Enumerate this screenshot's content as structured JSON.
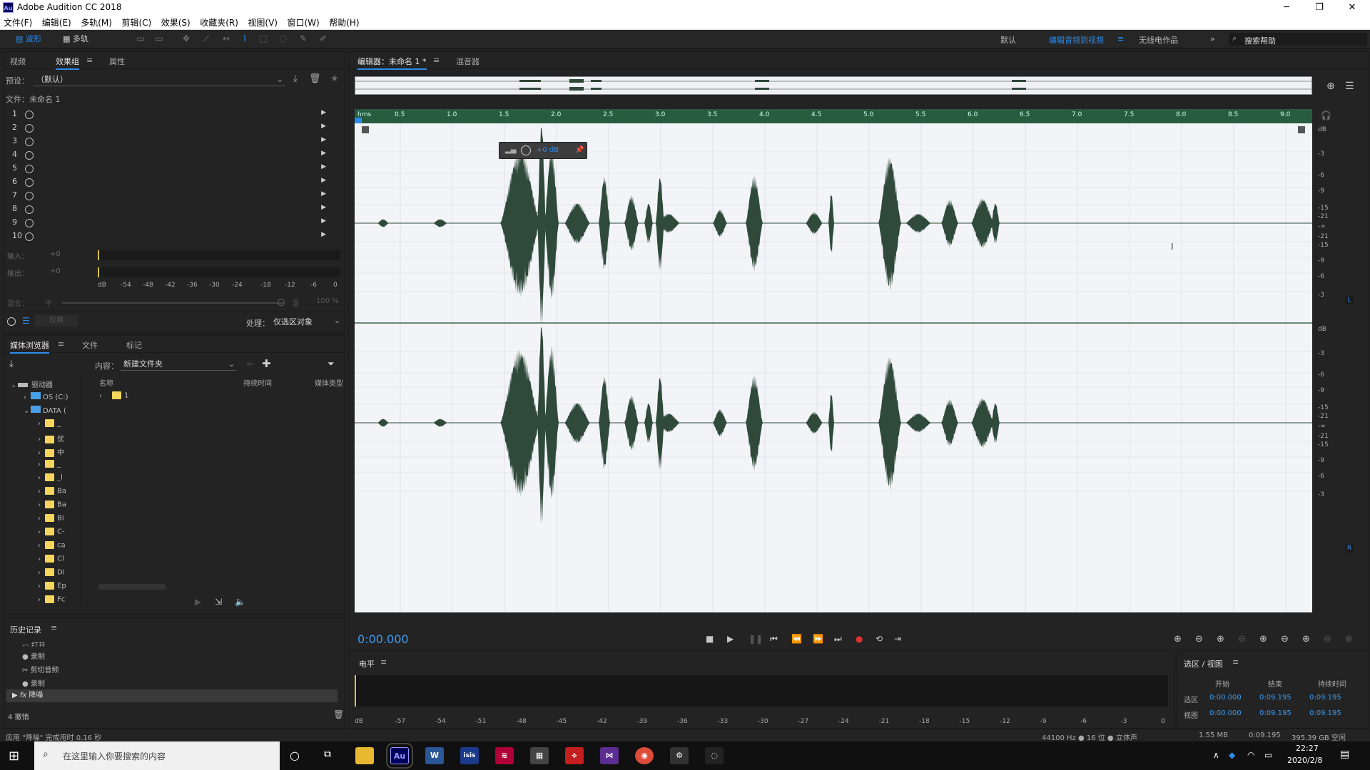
{
  "app": {
    "title": "Adobe Audition CC 2018",
    "logo": "Au"
  },
  "menu": [
    "文件(F)",
    "编辑(E)",
    "多轨(M)",
    "剪辑(C)",
    "效果(S)",
    "收藏夹(R)",
    "视图(V)",
    "窗口(W)",
    "帮助(H)"
  ],
  "toolbar": {
    "waveform": "波形",
    "multitrack": "多轨",
    "workspaces": [
      "默认",
      "编辑音频到视频",
      "无线电作品"
    ],
    "search_placeholder": "搜索帮助"
  },
  "left_panel": {
    "tabs": [
      "视频",
      "效果组",
      "属性"
    ],
    "preset_label": "预设：",
    "preset_value": "（默认）",
    "file_label": "文件：未命名 1",
    "rack_slots": [
      "1",
      "2",
      "3",
      "4",
      "5",
      "6",
      "7",
      "8",
      "9",
      "10"
    ],
    "input_label": "输入：",
    "output_label": "输出：",
    "input_gain": "+0",
    "output_gain": "+0",
    "meter_ticks": [
      "dB",
      "-54",
      "-48",
      "-42",
      "-36",
      "-30",
      "-24",
      "-18",
      "-12",
      "-6",
      "0"
    ],
    "mix_label": "混合：",
    "mix_dry": "干",
    "mix_wet": "湿",
    "mix_value": "100 %",
    "apply_label": "应用",
    "process_label": "处理：",
    "process_value": "仅选区对象"
  },
  "media_browser": {
    "tabs": [
      "媒体浏览器",
      "文件",
      "标记"
    ],
    "content_label": "内容：",
    "content_value": "新建文件夹",
    "root": "驱动器",
    "drives": [
      "OS (C:)",
      "DATA ("
    ],
    "folders": [
      "_",
      "优",
      "中",
      "_",
      "_l",
      "Ba",
      "Ba",
      "Bi",
      "C-",
      "ca",
      "Cl",
      "Di",
      "Ep",
      "Fc"
    ],
    "columns": [
      "名称",
      "持续时间",
      "媒体类型"
    ],
    "files": [
      "1"
    ]
  },
  "history": {
    "title": "历史记录",
    "items": [
      "打开",
      "录制",
      "剪切音频",
      "录制",
      "降噪"
    ],
    "undo_count": "4 撤销"
  },
  "editor": {
    "tab": "编辑器：未命名 1 *",
    "mixer_tab": "混音器",
    "ruler_unit": "hms",
    "ruler_ticks": [
      "0.5",
      "1.0",
      "1.5",
      "2.0",
      "2.5",
      "3.0",
      "3.5",
      "4.0",
      "4.5",
      "5.0",
      "5.5",
      "6.0",
      "6.5",
      "7.0",
      "7.5",
      "8.0",
      "8.5",
      "9.0"
    ],
    "hud_gain": "+0 dB",
    "db_labels_top": [
      "dB",
      "-3",
      "-6",
      "-9",
      "-15",
      "-21",
      "-∞",
      "-21",
      "-15",
      "-9",
      "-6",
      "-3"
    ],
    "db_labels_bottom": [
      "dB",
      "-3",
      "-6",
      "-9",
      "-15",
      "-21",
      "-∞",
      "-21",
      "-15",
      "-9",
      "-6",
      "-3"
    ],
    "channel_left": "L",
    "channel_right": "R",
    "time": "0:00.000"
  },
  "levels": {
    "title": "电平",
    "ticks": [
      "dB",
      "-57",
      "-54",
      "-51",
      "-48",
      "-45",
      "-42",
      "-39",
      "-36",
      "-33",
      "-30",
      "-27",
      "-24",
      "-21",
      "-18",
      "-15",
      "-12",
      "-9",
      "-6",
      "-3",
      "0"
    ]
  },
  "selection_view": {
    "title": "选区 / 视图",
    "headers": [
      "开始",
      "结束",
      "持续时间"
    ],
    "rows": [
      {
        "label": "选区",
        "start": "0:00.000",
        "end": "0:09.195",
        "duration": "0:09.195"
      },
      {
        "label": "视图",
        "start": "0:00.000",
        "end": "0:09.195",
        "duration": "0:09.195"
      }
    ]
  },
  "status": {
    "left": "应用 \"降噪\" 完成用时 0.16 秒",
    "format": "44100 Hz ● 16 位 ● 立体声",
    "size": "1.55 MB",
    "duration": "0:09.195",
    "free": "395.39 GB 空闲"
  },
  "taskbar": {
    "search_placeholder": "在这里输入你要搜索的内容",
    "time": "22:27",
    "date": "2020/2/8"
  },
  "colors": {
    "accent": "#2d8ceb",
    "waveform": "#2f4a3a",
    "ruler": "#275c3f",
    "record": "#e03030"
  }
}
